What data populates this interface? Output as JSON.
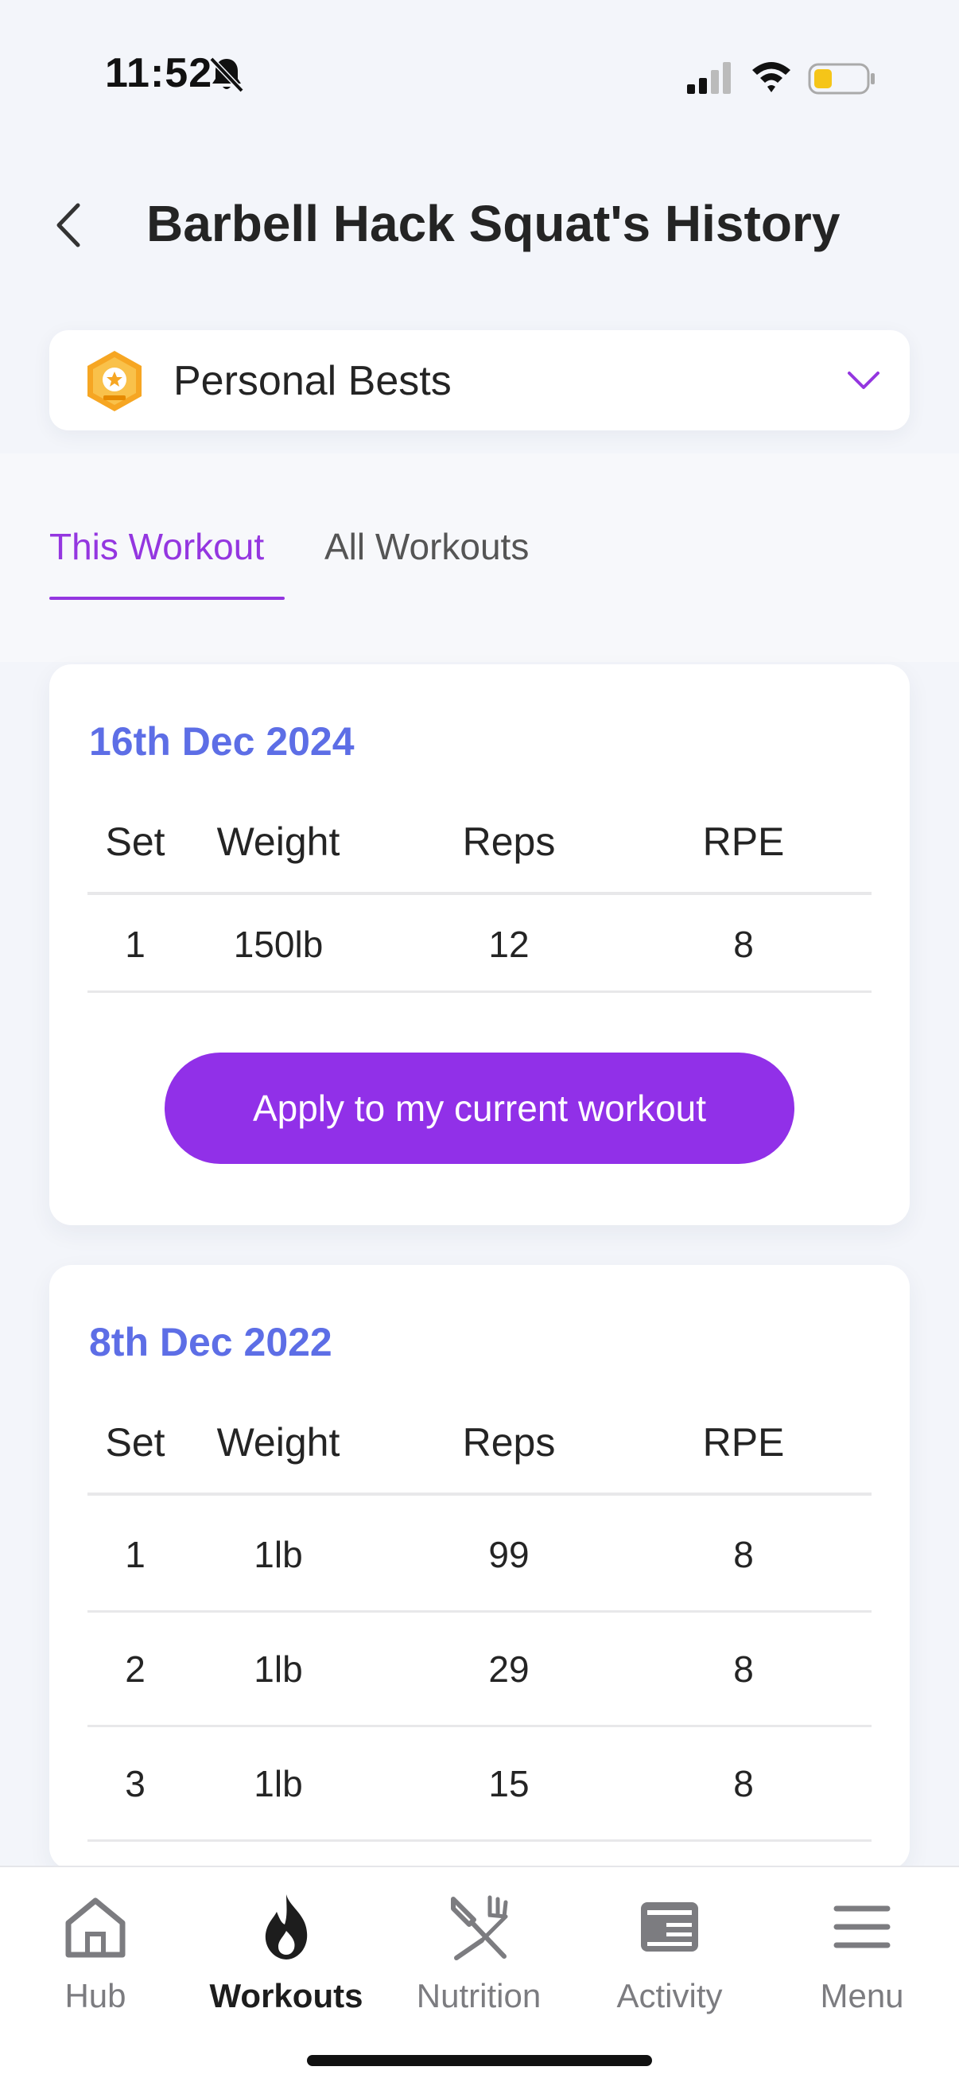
{
  "status_bar": {
    "time": "11:52"
  },
  "header": {
    "title": "Barbell Hack Squat's History"
  },
  "personal_bests": {
    "label": "Personal Bests"
  },
  "tabs": [
    {
      "label": "This Workout",
      "active": true
    },
    {
      "label": "All Workouts",
      "active": false
    }
  ],
  "table_headers": {
    "set": "Set",
    "weight": "Weight",
    "reps": "Reps",
    "rpe": "RPE"
  },
  "workouts": [
    {
      "date": "16th Dec 2024",
      "sets": [
        {
          "set": "1",
          "weight": "150lb",
          "reps": "12",
          "rpe": "8"
        }
      ],
      "apply_label": "Apply to my current workout"
    },
    {
      "date": "8th Dec 2022",
      "sets": [
        {
          "set": "1",
          "weight": "1lb",
          "reps": "99",
          "rpe": "8"
        },
        {
          "set": "2",
          "weight": "1lb",
          "reps": "29",
          "rpe": "8"
        },
        {
          "set": "3",
          "weight": "1lb",
          "reps": "15",
          "rpe": "8"
        }
      ]
    }
  ],
  "tabbar": [
    {
      "label": "Hub",
      "icon": "home-icon",
      "active": false
    },
    {
      "label": "Workouts",
      "icon": "flame-icon",
      "active": true
    },
    {
      "label": "Nutrition",
      "icon": "fork-knife-icon",
      "active": false
    },
    {
      "label": "Activity",
      "icon": "activity-card-icon",
      "active": false
    },
    {
      "label": "Menu",
      "icon": "hamburger-menu-icon",
      "active": false
    }
  ],
  "colors": {
    "accent": "#9436e0",
    "date": "#5d6ee6",
    "button": "#9130e8",
    "background": "#f3f5fa"
  }
}
